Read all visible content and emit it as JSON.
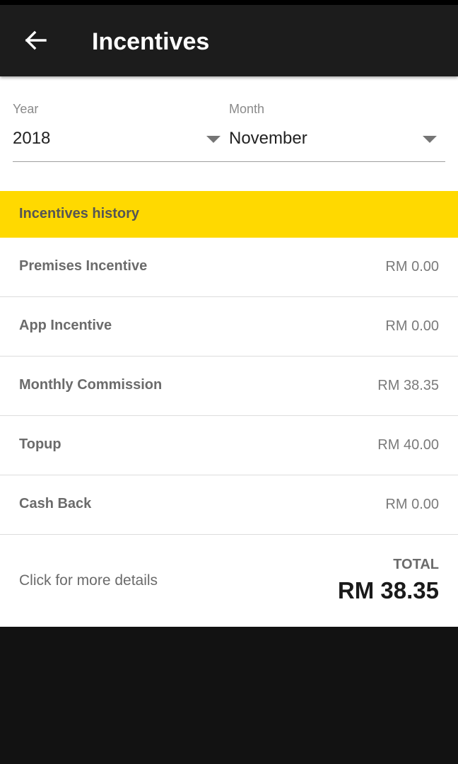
{
  "appbar": {
    "title": "Incentives",
    "back_icon": "arrow-left-icon"
  },
  "filters": {
    "year": {
      "label": "Year",
      "value": "2018"
    },
    "month": {
      "label": "Month",
      "value": "November"
    }
  },
  "history": {
    "header": "Incentives history",
    "items": [
      {
        "label": "Premises Incentive",
        "amount": "RM 0.00"
      },
      {
        "label": "App Incentive",
        "amount": "RM 0.00"
      },
      {
        "label": "Monthly Commission",
        "amount": "RM 38.35"
      },
      {
        "label": "Topup",
        "amount": "RM 40.00"
      },
      {
        "label": "Cash Back",
        "amount": "RM 0.00"
      }
    ]
  },
  "footer": {
    "more_details": "Click for more details",
    "total_label": "TOTAL",
    "total_amount": "RM 38.35"
  },
  "colors": {
    "appbar": "#1c1c1c",
    "accent": "#ffd900",
    "background": "#121212"
  }
}
